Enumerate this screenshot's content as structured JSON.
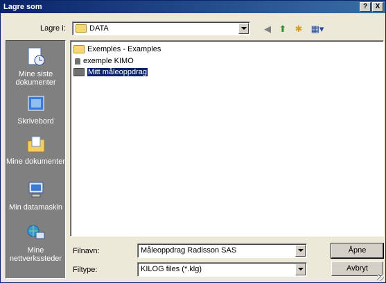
{
  "window": {
    "title": "Lagre som",
    "help_label": "?",
    "close_label": "X"
  },
  "location": {
    "label": "Lagre i:",
    "value": "DATA"
  },
  "toolbar": {
    "back_icon": "back-arrow-icon",
    "up_icon": "up-folder-icon",
    "new_folder_icon": "new-folder-icon",
    "view_icon": "view-menu-icon"
  },
  "places": [
    {
      "id": "recent",
      "label": "Mine siste dokumenter",
      "icon": "recent-documents-icon"
    },
    {
      "id": "desktop",
      "label": "Skrivebord",
      "icon": "desktop-icon"
    },
    {
      "id": "documents",
      "label": "Mine dokumenter",
      "icon": "my-documents-icon"
    },
    {
      "id": "computer",
      "label": "Min datamaskin",
      "icon": "my-computer-icon"
    },
    {
      "id": "network",
      "label": "Mine nettverkssteder",
      "icon": "network-places-icon"
    }
  ],
  "files": [
    {
      "label": "Exemples - Examples",
      "icon": "folder",
      "selected": false
    },
    {
      "label": "exemple KIMO",
      "icon": "locked-file",
      "selected": false
    },
    {
      "label": "Mitt måleoppdrag",
      "icon": "folder-dark",
      "selected": true
    }
  ],
  "filename": {
    "label": "Filnavn:",
    "value": "Måleoppdrag Radisson SAS"
  },
  "filetype": {
    "label": "Filtype:",
    "value": "KILOG files (*.klg)"
  },
  "buttons": {
    "open": "Åpne",
    "cancel": "Avbryt"
  }
}
